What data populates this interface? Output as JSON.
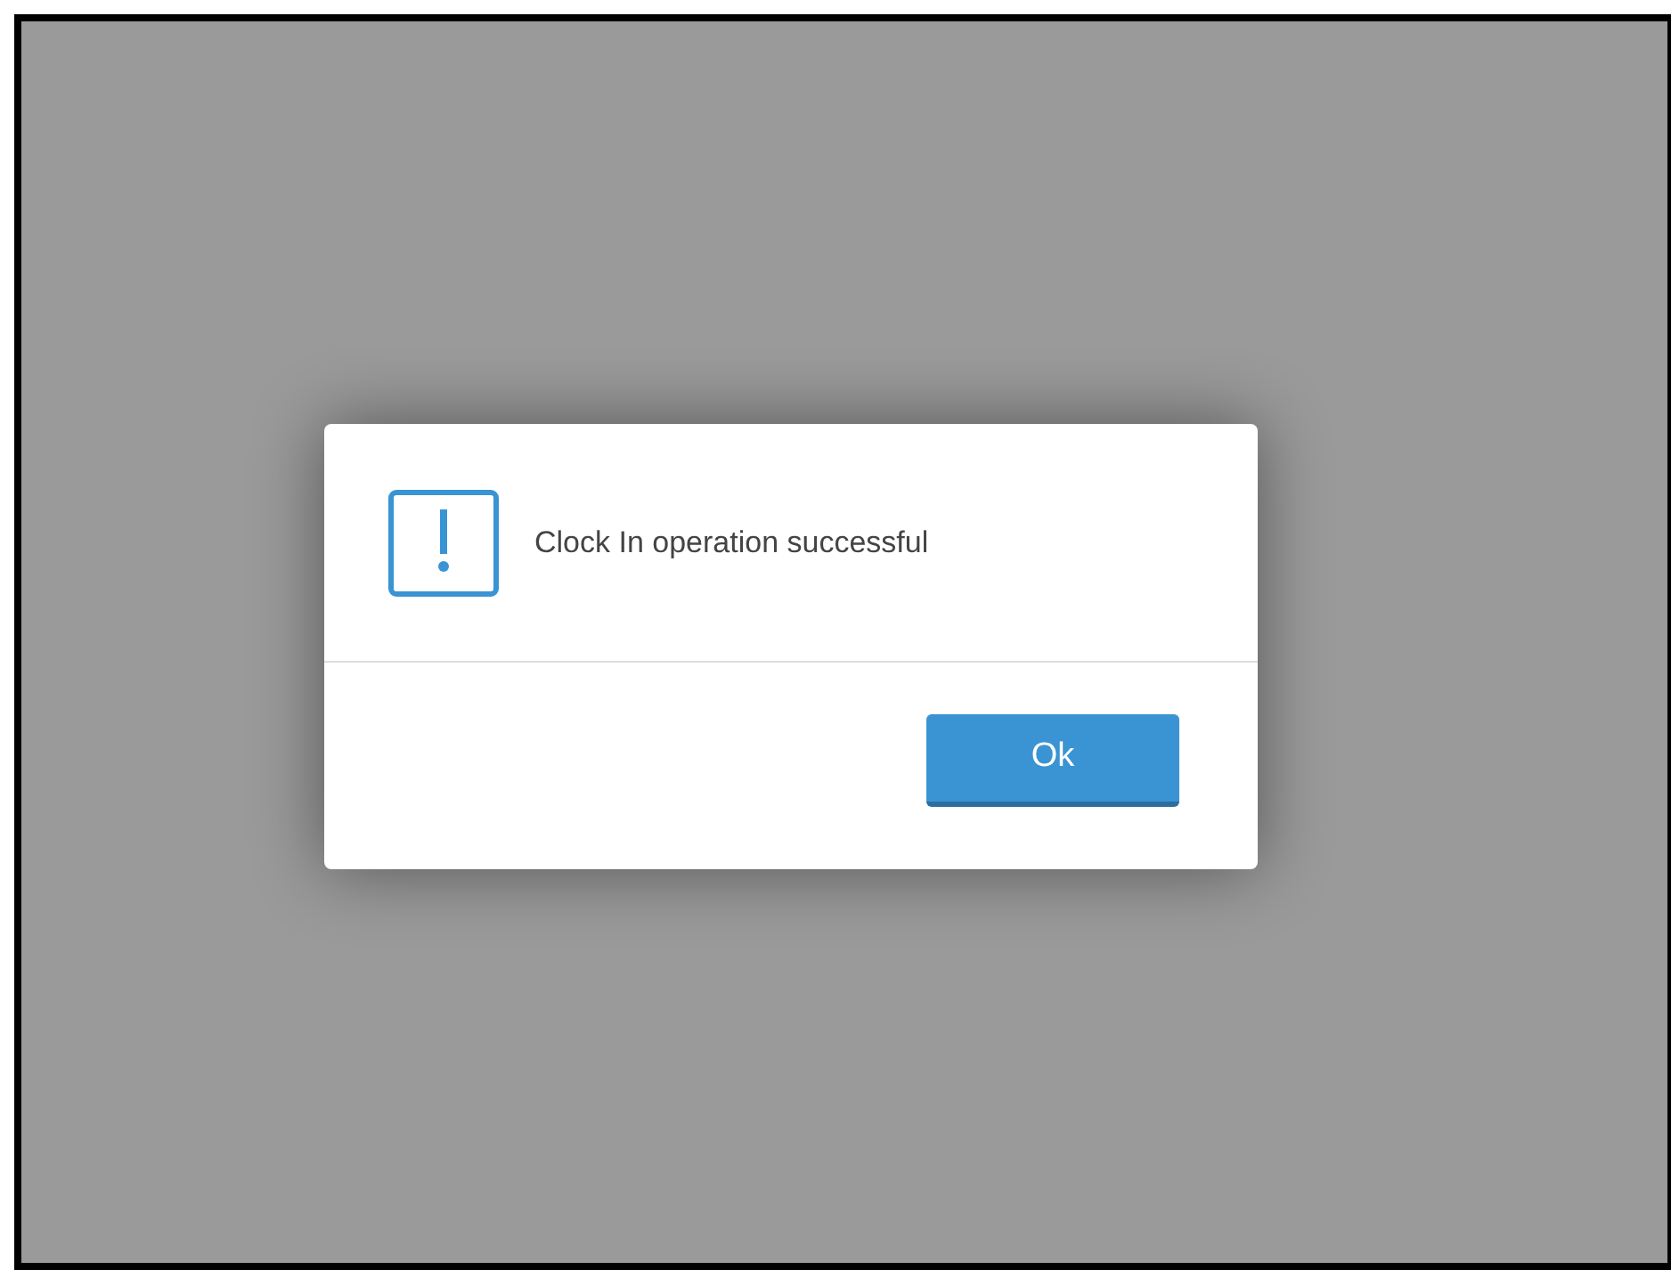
{
  "dialog": {
    "message": "Clock In operation successful",
    "buttons": [
      "Ok"
    ]
  }
}
